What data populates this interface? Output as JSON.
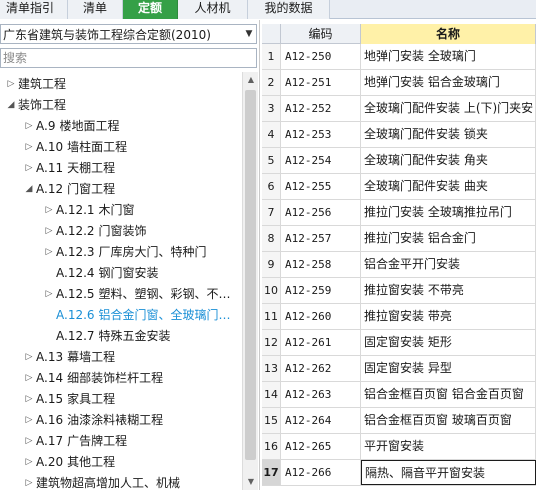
{
  "tabs": [
    "清单指引",
    "清单",
    "定额",
    "人材机",
    "我的数据"
  ],
  "quota_library": "广东省建筑与装饰工程综合定额(2010)",
  "search_placeholder": "搜索",
  "tree": [
    {
      "toggle": "▷",
      "code": "",
      "label": "建筑工程",
      "level": 0
    },
    {
      "toggle": "◢",
      "code": "",
      "label": "装饰工程",
      "level": 0
    },
    {
      "toggle": "▷",
      "code": "A.9",
      "label": "楼地面工程",
      "level": 1
    },
    {
      "toggle": "▷",
      "code": "A.10",
      "label": "墙柱面工程",
      "level": 1
    },
    {
      "toggle": "▷",
      "code": "A.11",
      "label": "天棚工程",
      "level": 1
    },
    {
      "toggle": "◢",
      "code": "A.12",
      "label": "门窗工程",
      "level": 1
    },
    {
      "toggle": "▷",
      "code": "A.12.1",
      "label": "木门窗",
      "level": 2
    },
    {
      "toggle": "▷",
      "code": "A.12.2",
      "label": "门窗装饰",
      "level": 2
    },
    {
      "toggle": "▷",
      "code": "A.12.3",
      "label": "厂库房大门、特种门",
      "level": 2
    },
    {
      "toggle": "",
      "code": "A.12.4",
      "label": "钢门窗安装",
      "level": 2
    },
    {
      "toggle": "▷",
      "code": "A.12.5",
      "label": "塑料、塑钢、彩钢、不…",
      "level": 2
    },
    {
      "toggle": "",
      "code": "A.12.6",
      "label": "铝合金门窗、全玻璃门…",
      "level": 2,
      "selected": true
    },
    {
      "toggle": "",
      "code": "A.12.7",
      "label": "特殊五金安装",
      "level": 2
    },
    {
      "toggle": "▷",
      "code": "A.13",
      "label": "幕墙工程",
      "level": 1
    },
    {
      "toggle": "▷",
      "code": "A.14",
      "label": "细部装饰栏杆工程",
      "level": 1
    },
    {
      "toggle": "▷",
      "code": "A.15",
      "label": "家具工程",
      "level": 1
    },
    {
      "toggle": "▷",
      "code": "A.16",
      "label": "油漆涂料裱糊工程",
      "level": 1
    },
    {
      "toggle": "▷",
      "code": "A.17",
      "label": "广告牌工程",
      "level": 1
    },
    {
      "toggle": "▷",
      "code": "A.20",
      "label": "其他工程",
      "level": 1
    },
    {
      "toggle": "▷",
      "code": "",
      "label": "建筑物超高增加人工、机械",
      "level": 1
    }
  ],
  "grid": {
    "headers": [
      "",
      "编码",
      "名称"
    ],
    "rows": [
      {
        "no": "1",
        "code": "A12-250",
        "name": "地弹门安装 全玻璃门"
      },
      {
        "no": "2",
        "code": "A12-251",
        "name": "地弹门安装 铝合金玻璃门"
      },
      {
        "no": "3",
        "code": "A12-252",
        "name": "全玻璃门配件安装 上(下)门夹安"
      },
      {
        "no": "4",
        "code": "A12-253",
        "name": "全玻璃门配件安装 锁夹"
      },
      {
        "no": "5",
        "code": "A12-254",
        "name": "全玻璃门配件安装 角夹"
      },
      {
        "no": "6",
        "code": "A12-255",
        "name": "全玻璃门配件安装 曲夹"
      },
      {
        "no": "7",
        "code": "A12-256",
        "name": "推拉门安装 全玻璃推拉吊门"
      },
      {
        "no": "8",
        "code": "A12-257",
        "name": "推拉门安装 铝合金门"
      },
      {
        "no": "9",
        "code": "A12-258",
        "name": "铝合金平开门安装"
      },
      {
        "no": "10",
        "code": "A12-259",
        "name": "推拉窗安装 不带亮"
      },
      {
        "no": "11",
        "code": "A12-260",
        "name": "推拉窗安装 带亮"
      },
      {
        "no": "12",
        "code": "A12-261",
        "name": "固定窗安装 矩形"
      },
      {
        "no": "13",
        "code": "A12-262",
        "name": "固定窗安装 异型"
      },
      {
        "no": "14",
        "code": "A12-263",
        "name": "铝合金框百页窗 铝合金百页窗"
      },
      {
        "no": "15",
        "code": "A12-264",
        "name": "铝合金框百页窗 玻璃百页窗"
      },
      {
        "no": "16",
        "code": "A12-265",
        "name": "平开窗安装"
      },
      {
        "no": "17",
        "code": "A12-266",
        "name": "隔热、隔音平开窗安装",
        "current": true
      }
    ]
  }
}
